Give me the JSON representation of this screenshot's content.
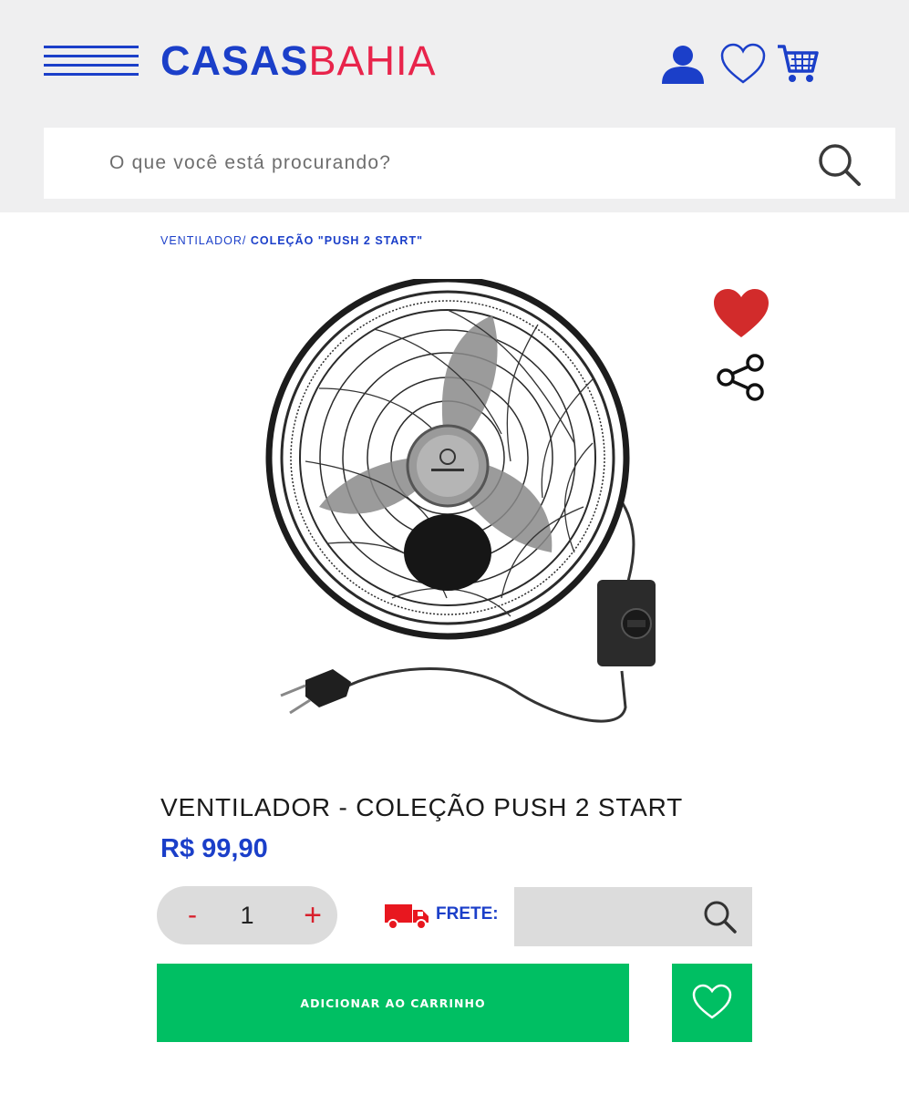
{
  "header": {
    "logo_part1": "CASAS",
    "logo_part2": "BAHIA",
    "icons": [
      "menu-icon",
      "user-icon",
      "heart-icon",
      "cart-icon"
    ]
  },
  "search": {
    "placeholder": "O que você está procurando?",
    "value": ""
  },
  "breadcrumb": {
    "items": [
      {
        "label": "VENTILADOR/ "
      },
      {
        "label": "COLEÇÃO \"PUSH 2 START\""
      }
    ]
  },
  "product": {
    "title": "VENTILADOR - COLEÇÃO PUSH 2 START",
    "price": "R$ 99,90",
    "favorited": true,
    "image": "wall-fan-with-speed-control"
  },
  "quantity": {
    "minus": "-",
    "value": "1",
    "plus": "+"
  },
  "shipping": {
    "label": "FRETE:",
    "value": ""
  },
  "actions": {
    "add_to_cart": "ADICIONAR AO CARRINHO"
  },
  "colors": {
    "brand_blue": "#1b3fc9",
    "brand_red": "#e8244b",
    "cta_green": "#00bf63",
    "favorite_red": "#d22b2b",
    "header_bg": "#efeff0"
  }
}
